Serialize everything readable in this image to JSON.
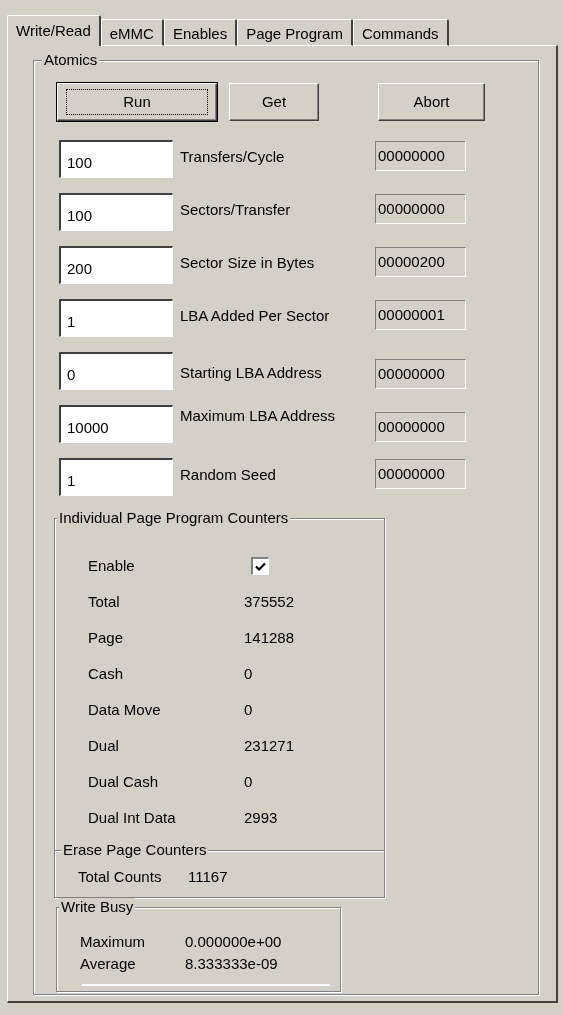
{
  "tabs": [
    {
      "label": "Write/Read",
      "selected": true
    },
    {
      "label": "eMMC",
      "selected": false
    },
    {
      "label": "Enables",
      "selected": false
    },
    {
      "label": "Page Program",
      "selected": false
    },
    {
      "label": "Commands",
      "selected": false
    }
  ],
  "atomics": {
    "title": "Atomics",
    "buttons": [
      {
        "label": "Run",
        "focused": true
      },
      {
        "label": "Get",
        "focused": false
      },
      {
        "label": "Abort",
        "focused": false
      }
    ],
    "params": [
      {
        "value": "100",
        "label": "Transfers/Cycle",
        "readout": "00000000"
      },
      {
        "value": "100",
        "label": "Sectors/Transfer",
        "readout": "00000000"
      },
      {
        "value": "200",
        "label": "Sector Size in Bytes",
        "readout": "00000200"
      },
      {
        "value": "1",
        "label": "LBA Added Per Sector",
        "readout": "00000001"
      },
      {
        "value": "0",
        "label": "Starting LBA Address",
        "readout": "00000000"
      },
      {
        "value": "10000",
        "label": "Maximum LBA Address",
        "readout": "00000000"
      },
      {
        "value": "1",
        "label": "Random Seed",
        "readout": "00000000"
      }
    ]
  },
  "page_counters": {
    "title": "Individual Page Program Counters",
    "enable": {
      "label": "Enable",
      "checked": true
    },
    "rows": [
      {
        "label": "Total",
        "value": "375552"
      },
      {
        "label": "Page",
        "value": "141288"
      },
      {
        "label": "Cash",
        "value": "0"
      },
      {
        "label": "Data Move",
        "value": "0"
      },
      {
        "label": "Dual",
        "value": "231271"
      },
      {
        "label": "Dual Cash",
        "value": "0"
      },
      {
        "label": "Dual Int Data",
        "value": "2993"
      }
    ]
  },
  "erase_counters": {
    "title": "Erase Page Counters",
    "rows": [
      {
        "label": "Total Counts",
        "value": "11167"
      }
    ]
  },
  "write_busy": {
    "title": "Write Busy",
    "rows": [
      {
        "label": "Maximum",
        "value": "0.000000e+00"
      },
      {
        "label": "Average",
        "value": "8.333333e-09"
      }
    ]
  }
}
